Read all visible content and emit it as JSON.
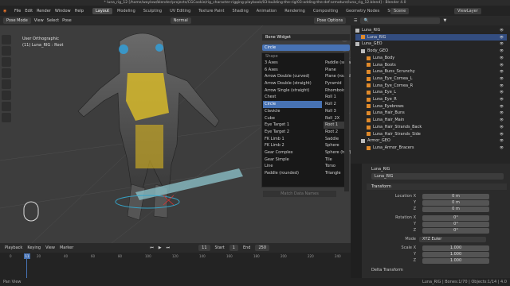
{
  "window_title": "* luna_rig_12 [/home/waylow/blender/projects/CGCookie/rig_character-rigging-playbook/03-building-the-rig/03-adding-the-def-armature/luna_rig_12.blend] - Blender 4.0",
  "menu": [
    "File",
    "Edit",
    "Render",
    "Window",
    "Help"
  ],
  "workspaces": [
    "Layout",
    "Modeling",
    "Sculpting",
    "UV Editing",
    "Texture Paint",
    "Shading",
    "Animation",
    "Rendering",
    "Compositing",
    "Geometry Nodes",
    "Scripting"
  ],
  "active_workspace": "Layout",
  "scene": "Scene",
  "view_layer": "ViewLayer",
  "viewport": {
    "mode": "Pose Mode",
    "orientation": "Normal",
    "pose_options": "Pose Options",
    "info_line1": "User Orthographic",
    "info_line2": "(11) Luna_RIG : Root"
  },
  "bone_widget": {
    "header": "Bone Widget",
    "current": "Circle",
    "shape_label": "Shape",
    "match_button": "Match Data Names",
    "col1": [
      "3 Axes",
      "6 Axes",
      "Arrow Double (curved)",
      "Arrow Double (straight)",
      "Arrow Single (straight)",
      "Chest",
      "Circle",
      "Clavicle",
      "Cube",
      "Eye Target 1",
      "Eye Target 2",
      "FK Limb 1",
      "FK Limb 2",
      "Gear Complex",
      "Gear Simple",
      "Line",
      "Paddle (rounded)"
    ],
    "col2": [
      "Paddle (square)",
      "Plane",
      "Plane (rounded)",
      "Pyramid",
      "Rhomboid",
      "Roll 1",
      "Roll 2",
      "Roll 3",
      "Roll_2X",
      "Root 1",
      "Root 2",
      "Saddle",
      "Sphere",
      "Sphere (half)",
      "Tile",
      "Torso",
      "Triangle"
    ],
    "selected": "Circle",
    "hovered": "Root 1"
  },
  "outliner": [
    {
      "name": "Luna_RIG",
      "indent": 0,
      "active": false
    },
    {
      "name": "Luna_RIG",
      "indent": 1,
      "active": true
    },
    {
      "name": "Luna_GEO",
      "indent": 0,
      "active": false
    },
    {
      "name": "Body_GEO",
      "indent": 1,
      "active": false
    },
    {
      "name": "Luna_Body",
      "indent": 2,
      "active": false
    },
    {
      "name": "Luna_Boots",
      "indent": 2,
      "active": false
    },
    {
      "name": "Luna_Buns_Scrunchy",
      "indent": 2,
      "active": false
    },
    {
      "name": "Luna_Eye_Cornea_L",
      "indent": 2,
      "active": false
    },
    {
      "name": "Luna_Eye_Cornea_R",
      "indent": 2,
      "active": false
    },
    {
      "name": "Luna_Eye_L",
      "indent": 2,
      "active": false
    },
    {
      "name": "Luna_Eye_R",
      "indent": 2,
      "active": false
    },
    {
      "name": "Luna_Eyebrows",
      "indent": 2,
      "active": false
    },
    {
      "name": "Luna_Hair_Buns",
      "indent": 2,
      "active": false
    },
    {
      "name": "Luna_Hair_Main",
      "indent": 2,
      "active": false
    },
    {
      "name": "Luna_Hair_Strands_Back",
      "indent": 2,
      "active": false
    },
    {
      "name": "Luna_Hair_Strands_Side",
      "indent": 2,
      "active": false
    },
    {
      "name": "Armor_GEO",
      "indent": 1,
      "active": false
    },
    {
      "name": "Luna_Armor_Bracers",
      "indent": 2,
      "active": false
    }
  ],
  "properties": {
    "object": "Luna_RIG",
    "data": "Luna_RIG",
    "transform": "Transform",
    "location": {
      "label": "Location X",
      "x": "0 m",
      "y": "0 m",
      "z": "0 m"
    },
    "rotation": {
      "label": "Rotation X",
      "x": "0°",
      "y": "0°",
      "z": "0°"
    },
    "mode_label": "Mode",
    "mode": "XYZ Euler",
    "scale": {
      "label": "Scale X",
      "x": "1.000",
      "y": "1.000",
      "z": "1.000"
    },
    "y": "Y",
    "z": "Z",
    "delta": "Delta Transform"
  },
  "timeline": {
    "playback": "Playback",
    "keying": "Keying",
    "view": "View",
    "marker": "Marker",
    "current_frame": "11",
    "start_label": "Start",
    "start": "1",
    "end_label": "End",
    "end": "250",
    "ticks": [
      "0",
      "11",
      "20",
      "40",
      "60",
      "80",
      "100",
      "120",
      "140",
      "160",
      "180",
      "200",
      "220",
      "240"
    ]
  },
  "status": {
    "left": "Pan View",
    "right": "Luna_RIG | Bones:1/70 | Objects:1/14 | 4.0"
  }
}
